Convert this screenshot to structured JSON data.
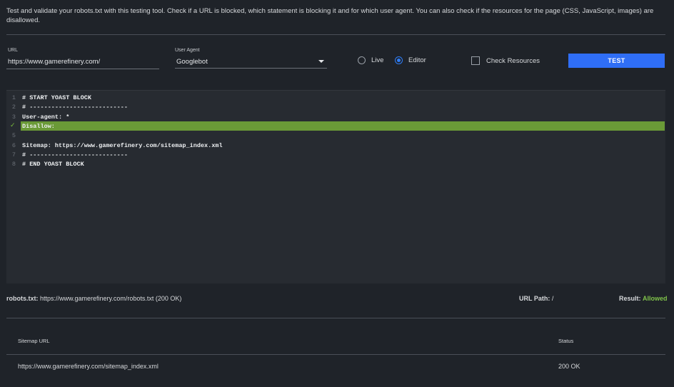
{
  "intro": "Test and validate your robots.txt with this testing tool. Check if a URL is blocked, which statement is blocking it and for which user agent. You can also check if the resources for the page (CSS, JavaScript, images) are disallowed.",
  "form": {
    "url_label": "URL",
    "url_value": "https://www.gamerefinery.com/",
    "user_agent_label": "User Agent",
    "user_agent_value": "Googlebot",
    "mode_live": "Live",
    "mode_editor": "Editor",
    "selected_mode": "Editor",
    "check_resources_label": "Check Resources",
    "check_resources_checked": false,
    "test_button": "TEST"
  },
  "editor": {
    "lines": [
      {
        "num": "1",
        "code": "# START YOAST BLOCK"
      },
      {
        "num": "2",
        "code": "# ---------------------------"
      },
      {
        "num": "3",
        "code": "User-agent: *"
      },
      {
        "num": "✓",
        "code": "Disallow:"
      },
      {
        "num": "5",
        "code": ""
      },
      {
        "num": "6",
        "code": "Sitemap: https://www.gamerefinery.com/sitemap_index.xml"
      },
      {
        "num": "7",
        "code": "# ---------------------------"
      },
      {
        "num": "8",
        "code": "# END YOAST BLOCK"
      }
    ],
    "highlight_color": "#6a9a37"
  },
  "result": {
    "robots_label": "robots.txt:",
    "robots_value": "https://www.gamerefinery.com/robots.txt (200 OK)",
    "url_path_label": "URL Path:",
    "url_path_value": "/",
    "result_label": "Result:",
    "result_value": "Allowed"
  },
  "sitemaps": {
    "headers": {
      "url": "Sitemap URL",
      "status": "Status"
    },
    "rows": [
      {
        "url": "https://www.gamerefinery.com/sitemap_index.xml",
        "status": "200 OK"
      }
    ]
  },
  "colors": {
    "accent": "#2f6ef6",
    "success": "#7fc24a",
    "background": "#1f2329"
  }
}
